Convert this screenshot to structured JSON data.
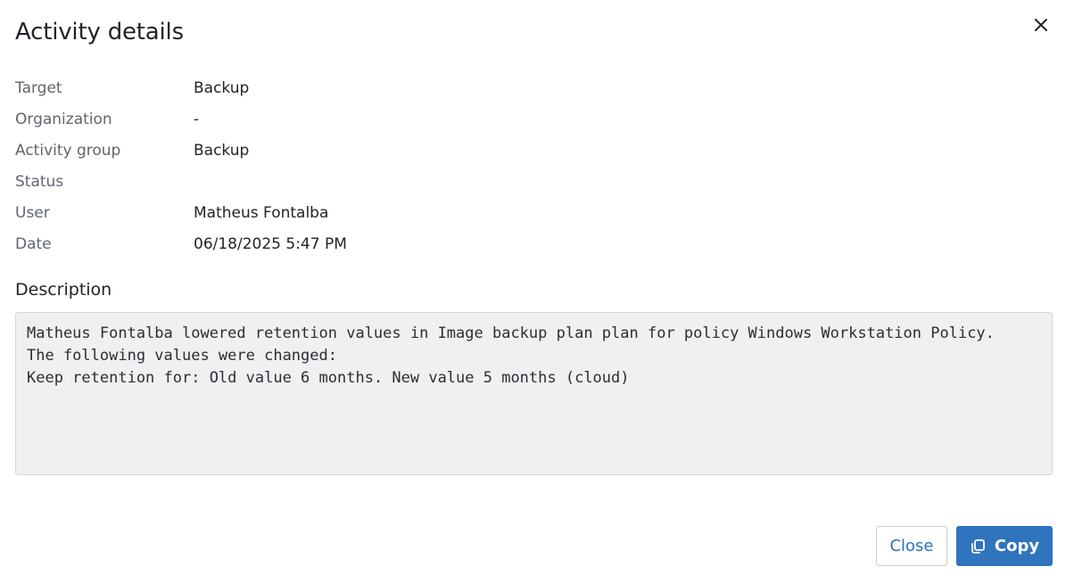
{
  "dialog": {
    "title": "Activity details"
  },
  "details": [
    {
      "label": "Target",
      "value": "Backup"
    },
    {
      "label": "Organization",
      "value": "-"
    },
    {
      "label": "Activity group",
      "value": "Backup"
    },
    {
      "label": "Status",
      "value": ""
    },
    {
      "label": "User",
      "value": "Matheus Fontalba"
    },
    {
      "label": "Date",
      "value": "06/18/2025 5:47 PM"
    }
  ],
  "description": {
    "heading": "Description",
    "lines": [
      "Matheus Fontalba lowered retention values in Image backup plan plan for policy Windows Workstation Policy.",
      "The following values were changed:",
      "Keep retention for: Old value 6 months. New value 5 months (cloud)"
    ]
  },
  "footer": {
    "close_label": "Close",
    "copy_label": "Copy"
  },
  "icons": {
    "close": "close-icon",
    "copy": "copy-icon"
  },
  "colors": {
    "primary": "#2f74bd",
    "link": "#2d72b8",
    "description_bg": "#eff0f2"
  }
}
